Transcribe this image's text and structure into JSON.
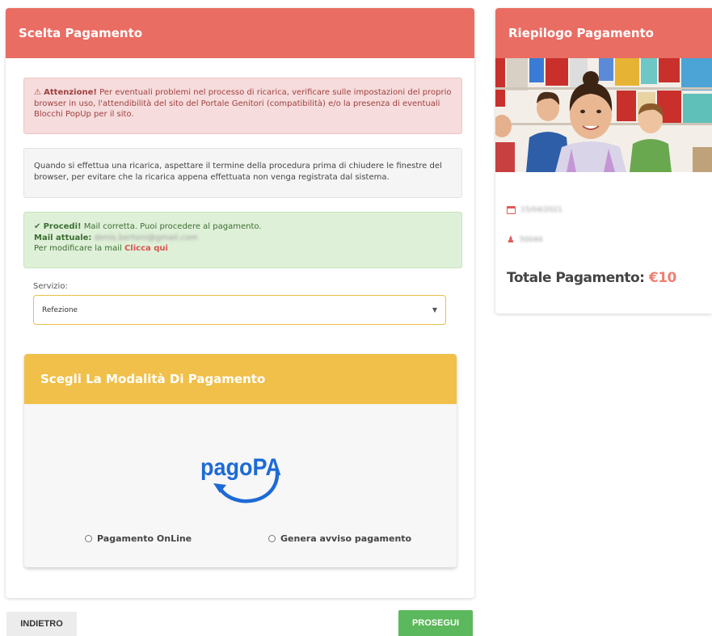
{
  "payment_choice": {
    "header": "Scelta Pagamento",
    "alert_warning": {
      "title": "Attenzione!",
      "text": "Per eventuali problemi nel processo di ricarica, verificare sulle impostazioni del proprio browser in uso, l'attendibilità del sito del Portale Genitori (compatibilità) e/o la presenza di eventuali Blocchi PopUp per il sito."
    },
    "alert_info": {
      "text": "Quando si effettua una ricarica, aspettare il termine della procedura prima di chiudere le finestre del browser, per evitare che la ricarica appena effettuata non venga registrata dal sistema."
    },
    "alert_success": {
      "title": "Procedi!",
      "text": "Mail corretta. Puoi procedere al pagamento.",
      "mail_label": "Mail attuale:",
      "mail_value": "denis.bertoni@gmail.com",
      "modify_text": "Per modificare la mail",
      "modify_link": "Clicca qui"
    },
    "service_label": "Servizio:",
    "service_selected": "Refezione",
    "method_header": "Scegli La Modalità Di Pagamento",
    "logo_text": "pagoPA",
    "options": [
      "Pagamento OnLine",
      "Genera avviso pagamento"
    ]
  },
  "buttons": {
    "back": "INDIETRO",
    "next": "PROSEGUI"
  },
  "summary": {
    "header": "Riepilogo Pagamento",
    "date": "15/04/2021",
    "code": "50044",
    "total_label": "Totale Pagamento:",
    "total_amount": "€10"
  },
  "colors": {
    "header_red": "#e96d63",
    "header_yellow": "#f0c04a",
    "success_green": "#5cb85c",
    "pagopa_blue": "#1d6ad6"
  },
  "icons": {
    "warning": "warning-triangle-icon",
    "check": "check-icon",
    "caret": "caret-down-icon",
    "calendar": "calendar-icon",
    "user": "user-icon"
  }
}
